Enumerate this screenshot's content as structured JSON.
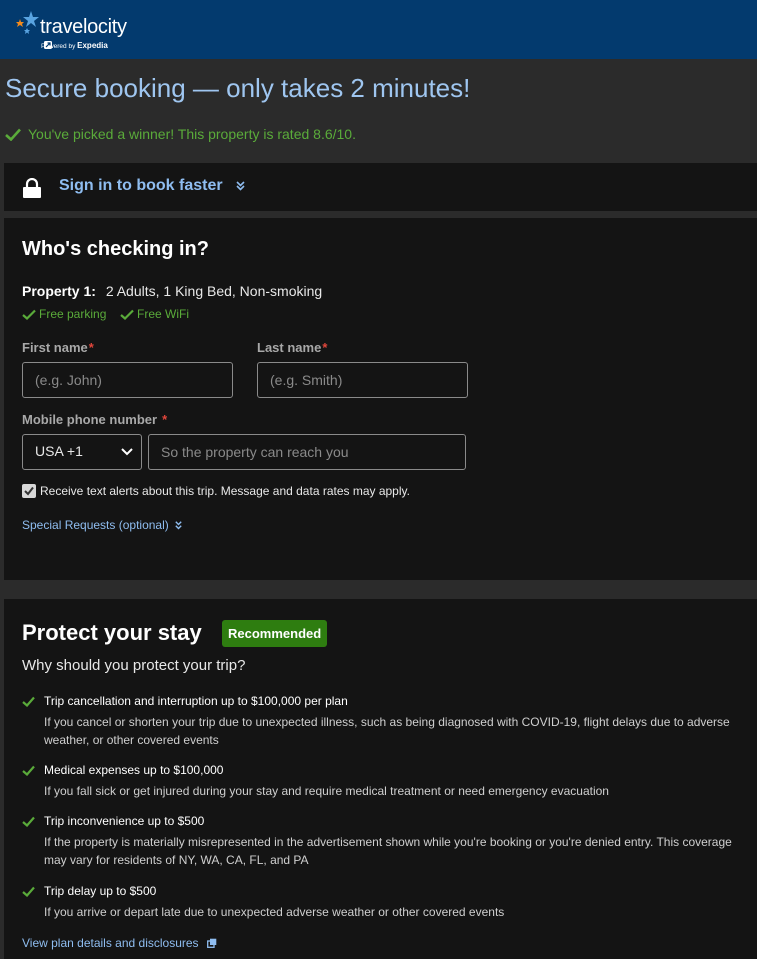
{
  "header": {
    "brand": "travelocity",
    "powered_prefix": "Powered by",
    "powered_brand": "Expedia",
    "colors": {
      "bar": "#033a6e",
      "star_orange": "#f28a1c",
      "star_blue": "#59a3e0"
    }
  },
  "page_title": "Secure booking — only takes 2 minutes!",
  "winner_message": "You've picked a winner! This property is rated 8.6/10.",
  "signin": {
    "label": "Sign in to book faster",
    "icon": "lock-icon"
  },
  "checkin": {
    "heading": "Who's checking in?",
    "property_label": "Property 1:",
    "property_details": "2 Adults, 1 King Bed, Non-smoking",
    "amenities": [
      "Free parking",
      "Free WiFi"
    ],
    "first_name": {
      "label": "First name",
      "required_mark": "*",
      "placeholder": "(e.g. John)",
      "value": ""
    },
    "last_name": {
      "label": "Last name",
      "required_mark": "*",
      "placeholder": "(e.g. Smith)",
      "value": ""
    },
    "phone": {
      "label": "Mobile phone number",
      "required_mark": "*",
      "country_code": "USA +1",
      "placeholder": "So the property can reach you",
      "value": ""
    },
    "text_alerts": {
      "label": "Receive text alerts about this trip. Message and data rates may apply.",
      "checked": true
    },
    "special_requests": "Special Requests (optional)"
  },
  "protect": {
    "title": "Protect your stay",
    "badge": "Recommended",
    "subtitle": "Why should you protect your trip?",
    "benefits": [
      {
        "title": "Trip cancellation and interruption up to $100,000 per plan",
        "desc": "If you cancel or shorten your trip due to unexpected illness, such as being diagnosed with COVID-19, flight delays due to adverse weather, or other covered events"
      },
      {
        "title": "Medical expenses up to $100,000",
        "desc": "If you fall sick or get injured during your stay and require medical treatment or need emergency evacuation"
      },
      {
        "title": "Trip inconvenience up to $500",
        "desc": "If the property is materially misrepresented in the advertisement shown while you're booking or you're denied entry. This coverage may vary for residents of NY, WA, CA, FL, and PA"
      },
      {
        "title": "Trip delay up to $500",
        "desc": "If you arrive or depart late due to unexpected adverse weather or other covered events"
      }
    ],
    "plan_link": "View plan details and disclosures"
  },
  "colors": {
    "link": "#8fbdf0",
    "title_blue": "#9fc6f0",
    "success_green": "#5aab3a",
    "badge_green": "#2e7d10",
    "required_red": "#e2463b"
  }
}
